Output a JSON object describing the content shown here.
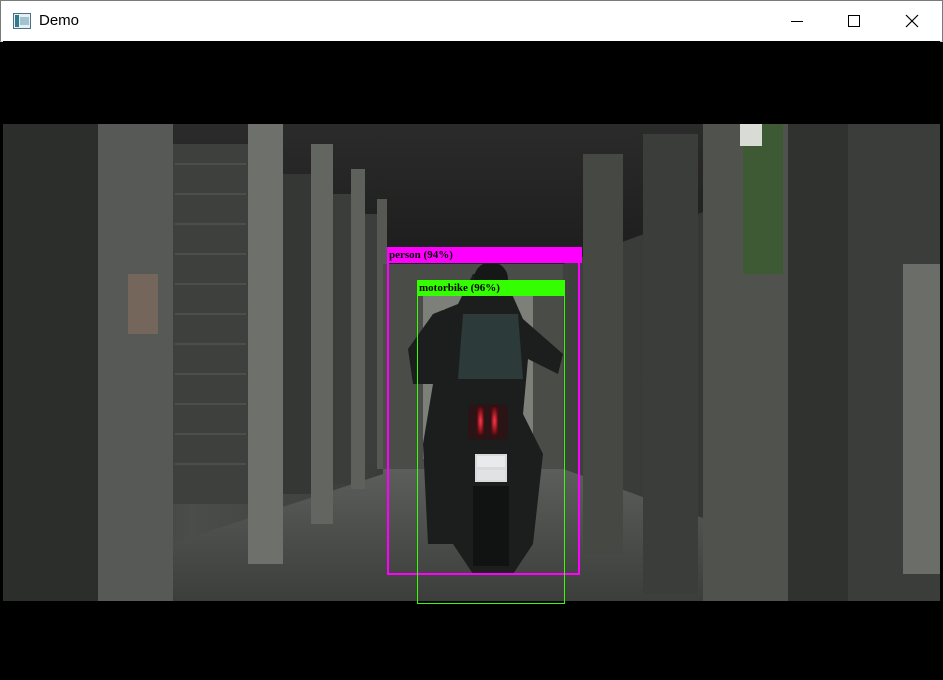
{
  "window": {
    "title": "Demo",
    "icon": "app-window-icon",
    "controls": [
      "minimize-icon",
      "maximize-icon",
      "close-icon"
    ]
  },
  "detections": [
    {
      "label": "person (94%)",
      "color": "#ff00ff"
    },
    {
      "label": "motorbike (96%)",
      "color": "#33ff00"
    }
  ]
}
